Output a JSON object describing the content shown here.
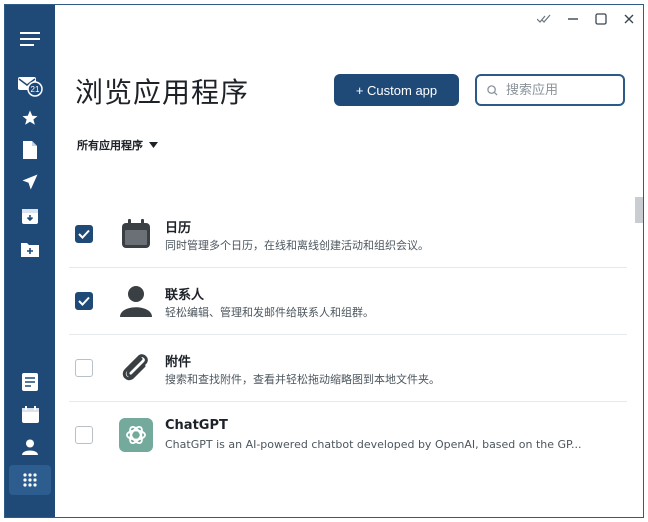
{
  "header": {
    "title": "浏览应用程序",
    "custom_app_label": "+ Custom app",
    "search_placeholder": "搜索应用",
    "search_value": ""
  },
  "filter": {
    "label": "所有应用程序"
  },
  "apps": [
    {
      "name": "日历",
      "description": "同时管理多个日历，在线和离线创建活动和组织会议。",
      "checked": true,
      "icon": "calendar-icon"
    },
    {
      "name": "联系人",
      "description": "轻松编辑、管理和发邮件给联系人和组群。",
      "checked": true,
      "icon": "person-icon"
    },
    {
      "name": "附件",
      "description": "搜索和查找附件，查看并轻松拖动缩略图到本地文件夹。",
      "checked": false,
      "icon": "paperclip-icon"
    },
    {
      "name": "ChatGPT",
      "description": "ChatGPT is an AI-powered chatbot developed by OpenAI, based on the GP...",
      "checked": false,
      "icon": "chatgpt-icon"
    }
  ],
  "sidebar": {
    "badge_count": "21",
    "items": [
      "menu-icon",
      "inbox-icon",
      "star-icon",
      "file-icon",
      "send-icon",
      "archive-icon",
      "folder-plus-icon",
      "notes-icon",
      "calendar-icon",
      "contacts-icon",
      "apps-grid-icon"
    ]
  },
  "colors": {
    "accent": "#1f4a78",
    "sidebar": "#1f4a78",
    "chatgpt": "#74aa9c"
  }
}
